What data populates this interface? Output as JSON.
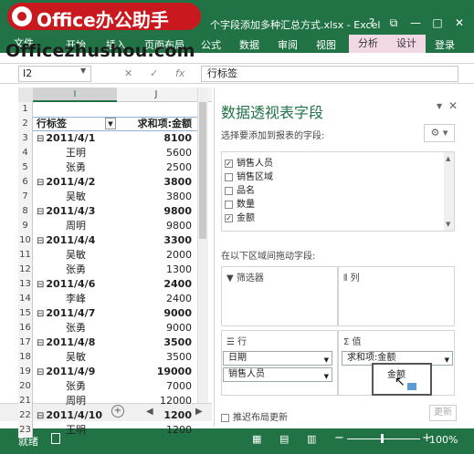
{
  "window": {
    "title": "个字段添加多种汇总方式.xlsx - Excel",
    "controls": [
      "?",
      "⧉",
      "—",
      "□",
      "✕"
    ]
  },
  "watermark": {
    "logo_text": "Office办公助手",
    "url_text": "Officezhushou.com"
  },
  "ribbon": {
    "file_tab": "文件",
    "tabs": [
      "开始",
      "插入",
      "页面布局",
      "公式",
      "数据",
      "审阅",
      "视图"
    ],
    "context_tabs": [
      "分析",
      "设计"
    ],
    "login": "登录"
  },
  "formula_bar": {
    "name_box": "I2",
    "cancel": "✕",
    "enter": "✓",
    "fx": "fx",
    "value": "行标签"
  },
  "grid": {
    "columns": [
      "I",
      "J"
    ],
    "header_row": {
      "row": "2",
      "label": "行标签",
      "value": "求和项:金额"
    },
    "rows": [
      {
        "row": "3",
        "label": "2011/4/1",
        "value": "8100",
        "kind": "date"
      },
      {
        "row": "4",
        "label": "王明",
        "value": "5600",
        "kind": "person"
      },
      {
        "row": "5",
        "label": "张勇",
        "value": "2500",
        "kind": "person"
      },
      {
        "row": "6",
        "label": "2011/4/2",
        "value": "3800",
        "kind": "date"
      },
      {
        "row": "7",
        "label": "吴敏",
        "value": "3800",
        "kind": "person"
      },
      {
        "row": "8",
        "label": "2011/4/3",
        "value": "9800",
        "kind": "date"
      },
      {
        "row": "9",
        "label": "周明",
        "value": "9800",
        "kind": "person"
      },
      {
        "row": "10",
        "label": "2011/4/4",
        "value": "3300",
        "kind": "date"
      },
      {
        "row": "11",
        "label": "吴敏",
        "value": "2000",
        "kind": "person"
      },
      {
        "row": "12",
        "label": "张勇",
        "value": "1300",
        "kind": "person"
      },
      {
        "row": "13",
        "label": "2011/4/6",
        "value": "2400",
        "kind": "date"
      },
      {
        "row": "14",
        "label": "李峰",
        "value": "2400",
        "kind": "person"
      },
      {
        "row": "15",
        "label": "2011/4/7",
        "value": "9000",
        "kind": "date"
      },
      {
        "row": "16",
        "label": "张勇",
        "value": "9000",
        "kind": "person"
      },
      {
        "row": "17",
        "label": "2011/4/8",
        "value": "3500",
        "kind": "date"
      },
      {
        "row": "18",
        "label": "吴敏",
        "value": "3500",
        "kind": "person"
      },
      {
        "row": "19",
        "label": "2011/4/9",
        "value": "19000",
        "kind": "date"
      },
      {
        "row": "20",
        "label": "张勇",
        "value": "7000",
        "kind": "person"
      },
      {
        "row": "21",
        "label": "周明",
        "value": "12000",
        "kind": "person"
      },
      {
        "row": "22",
        "label": "2011/4/10",
        "value": "1200",
        "kind": "date"
      },
      {
        "row": "23",
        "label": "王明",
        "value": "1200",
        "kind": "person"
      }
    ]
  },
  "status": {
    "ready": "就绪",
    "zoom": "100%",
    "zoom_level_pct": 100
  },
  "panel": {
    "title": "数据透视表字段",
    "subtitle": "选择要添加到报表的字段:",
    "fields": [
      {
        "label": "销售人员",
        "checked": true
      },
      {
        "label": "销售区域",
        "checked": false
      },
      {
        "label": "品名",
        "checked": false
      },
      {
        "label": "数量",
        "checked": false
      },
      {
        "label": "金额",
        "checked": true
      }
    ],
    "drag_hint": "在以下区域间拖动字段:",
    "zones": {
      "filters": "筛选器",
      "columns": "列",
      "rows": "行",
      "values": "值"
    },
    "row_fields": [
      "日期",
      "销售人员"
    ],
    "value_fields": [
      "求和项:金额"
    ],
    "dragging_field": "金额",
    "defer_label": "推迟布局更新",
    "update_label": "更新"
  }
}
